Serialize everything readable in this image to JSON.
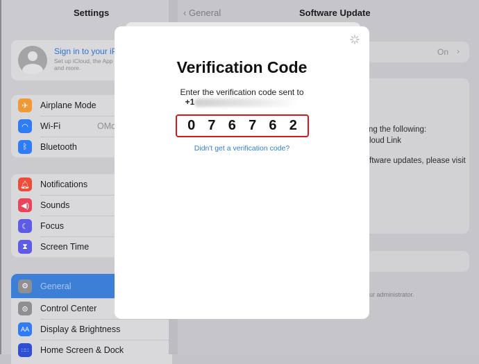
{
  "sidebar": {
    "title": "Settings",
    "account": {
      "title": "Sign in to your iPad",
      "subtitle_line1": "Set up iCloud, the App Store,",
      "subtitle_line2": "and more."
    },
    "group1": [
      {
        "label": "Airplane Mode",
        "icon": "airplane-icon",
        "color": "#f09a37"
      },
      {
        "label": "Wi-Fi",
        "value": "OMoutdoor",
        "icon": "wifi-icon",
        "color": "#2f7cf6"
      },
      {
        "label": "Bluetooth",
        "icon": "bluetooth-icon",
        "color": "#2f7cf6"
      }
    ],
    "group2": [
      {
        "label": "Notifications",
        "icon": "bell-icon",
        "color": "#eb4d3d"
      },
      {
        "label": "Sounds",
        "icon": "speaker-icon",
        "color": "#eb445a"
      },
      {
        "label": "Focus",
        "icon": "moon-icon",
        "color": "#5e5ce6"
      },
      {
        "label": "Screen Time",
        "icon": "hourglass-icon",
        "color": "#5e5ce6"
      }
    ],
    "group3": [
      {
        "label": "General",
        "icon": "gear-icon",
        "color": "#8e8e93",
        "selected": true
      },
      {
        "label": "Control Center",
        "icon": "toggles-icon",
        "color": "#8e8e93"
      },
      {
        "label": "Display & Brightness",
        "icon": "aa-icon",
        "color": "#2f7cf6"
      },
      {
        "label": "Home Screen & Dock",
        "icon": "grid-icon",
        "color": "#2f4ed6"
      }
    ]
  },
  "detail": {
    "back": "General",
    "title": "Software Update",
    "auto_value": "On",
    "text1": "ding the following:",
    "text2": "loud Link",
    "text3": "ftware updates, please visit",
    "footer": "ur administrator."
  },
  "modal": {
    "title": "Verification Code",
    "subtitle": "Enter the verification code sent to",
    "phone_prefix": "+1",
    "code": [
      "0",
      "7",
      "6",
      "7",
      "6",
      "2"
    ],
    "resend": "Didn't get a verification code?"
  }
}
